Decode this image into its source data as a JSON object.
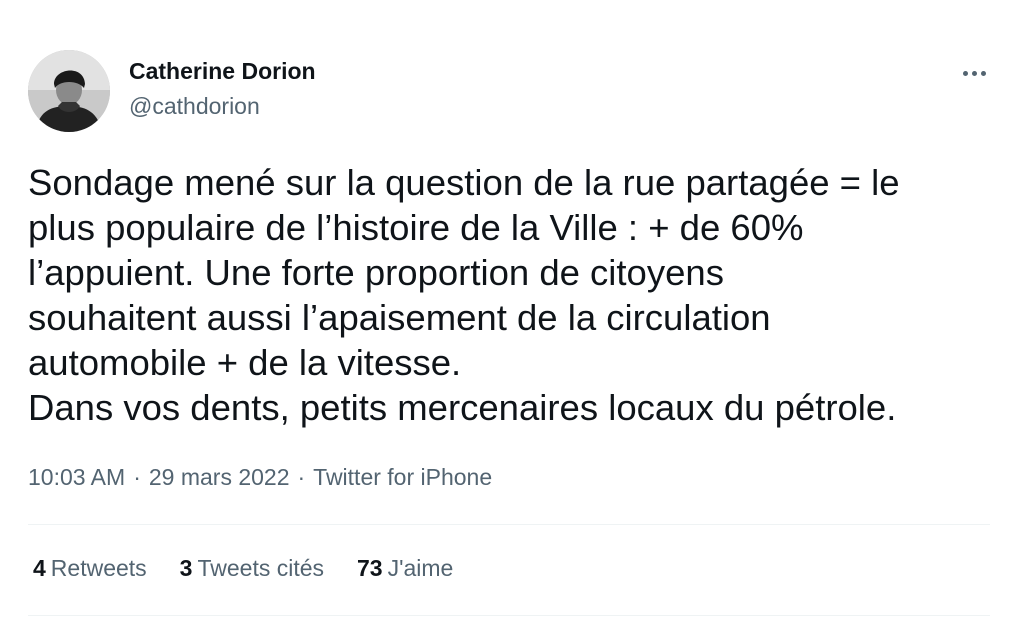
{
  "author": {
    "display_name": "Catherine Dorion",
    "handle": "@cathdorion",
    "avatar_icon": "profile-photo"
  },
  "more_icon": "more-horizontal-icon",
  "tweet": {
    "text_lines": [
      "Sondage mené sur la question de la rue partagée = le",
      "plus populaire de l’histoire de la Ville : + de 60%",
      "l’appuient. Une forte proportion de citoyens",
      "souhaitent aussi l’apaisement de la circulation",
      "automobile + de la vitesse.",
      "Dans vos dents, petits mercenaires locaux du pétrole."
    ]
  },
  "meta": {
    "time": "10:03 AM",
    "separator": "·",
    "date": "29 mars 2022",
    "source": "Twitter for iPhone"
  },
  "stats": {
    "retweets": {
      "count": "4",
      "label": "Retweets"
    },
    "quotes": {
      "count": "3",
      "label": "Tweets cités"
    },
    "likes": {
      "count": "73",
      "label": "J'aime"
    }
  },
  "colors": {
    "text_primary": "#0f1419",
    "text_secondary": "#536471",
    "divider": "#eff3f4",
    "background": "#ffffff"
  }
}
